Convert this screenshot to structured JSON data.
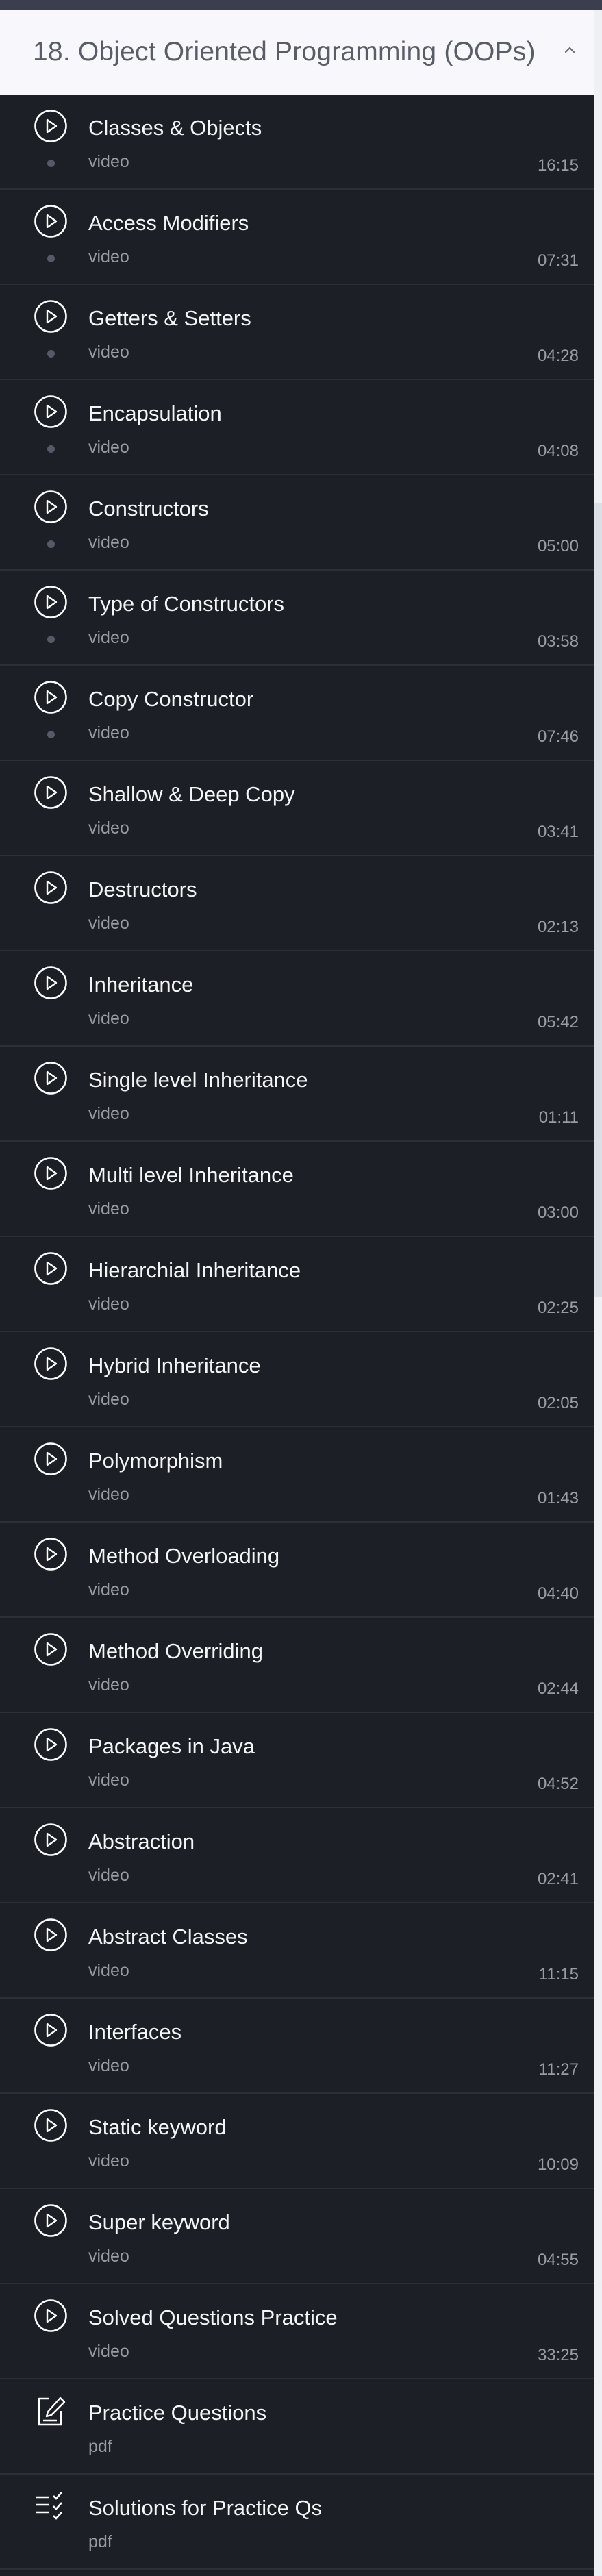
{
  "section": {
    "title": "18. Object Oriented Programming (OOPs)",
    "toggle_icon": "chevron-up-icon"
  },
  "colors": {
    "background": "#1d1f26",
    "header_background": "#f8f8fc",
    "divider": "#2c2f38",
    "title_text": "#f4f5f7",
    "meta_text": "#9a9ca4"
  },
  "lessons": [
    {
      "title": "Classes & Objects",
      "type": "video",
      "duration": "16:15",
      "icon": "play-circle-icon",
      "status_dot": true
    },
    {
      "title": "Access Modifiers",
      "type": "video",
      "duration": "07:31",
      "icon": "play-circle-icon",
      "status_dot": true
    },
    {
      "title": "Getters & Setters",
      "type": "video",
      "duration": "04:28",
      "icon": "play-circle-icon",
      "status_dot": true
    },
    {
      "title": "Encapsulation",
      "type": "video",
      "duration": "04:08",
      "icon": "play-circle-icon",
      "status_dot": true
    },
    {
      "title": "Constructors",
      "type": "video",
      "duration": "05:00",
      "icon": "play-circle-icon",
      "status_dot": true
    },
    {
      "title": "Type of Constructors",
      "type": "video",
      "duration": "03:58",
      "icon": "play-circle-icon",
      "status_dot": true
    },
    {
      "title": "Copy Constructor",
      "type": "video",
      "duration": "07:46",
      "icon": "play-circle-icon",
      "status_dot": true
    },
    {
      "title": "Shallow & Deep Copy",
      "type": "video",
      "duration": "03:41",
      "icon": "play-circle-icon",
      "status_dot": false
    },
    {
      "title": "Destructors",
      "type": "video",
      "duration": "02:13",
      "icon": "play-circle-icon",
      "status_dot": false
    },
    {
      "title": "Inheritance",
      "type": "video",
      "duration": "05:42",
      "icon": "play-circle-icon",
      "status_dot": false
    },
    {
      "title": "Single level Inheritance",
      "type": "video",
      "duration": "01:11",
      "icon": "play-circle-icon",
      "status_dot": false
    },
    {
      "title": "Multi level Inheritance",
      "type": "video",
      "duration": "03:00",
      "icon": "play-circle-icon",
      "status_dot": false
    },
    {
      "title": "Hierarchial Inheritance",
      "type": "video",
      "duration": "02:25",
      "icon": "play-circle-icon",
      "status_dot": false
    },
    {
      "title": "Hybrid Inheritance",
      "type": "video",
      "duration": "02:05",
      "icon": "play-circle-icon",
      "status_dot": false
    },
    {
      "title": "Polymorphism",
      "type": "video",
      "duration": "01:43",
      "icon": "play-circle-icon",
      "status_dot": false
    },
    {
      "title": "Method Overloading",
      "type": "video",
      "duration": "04:40",
      "icon": "play-circle-icon",
      "status_dot": false
    },
    {
      "title": "Method Overriding",
      "type": "video",
      "duration": "02:44",
      "icon": "play-circle-icon",
      "status_dot": false
    },
    {
      "title": "Packages in Java",
      "type": "video",
      "duration": "04:52",
      "icon": "play-circle-icon",
      "status_dot": false
    },
    {
      "title": "Abstraction",
      "type": "video",
      "duration": "02:41",
      "icon": "play-circle-icon",
      "status_dot": false
    },
    {
      "title": "Abstract Classes",
      "type": "video",
      "duration": "11:15",
      "icon": "play-circle-icon",
      "status_dot": false
    },
    {
      "title": "Interfaces",
      "type": "video",
      "duration": "11:27",
      "icon": "play-circle-icon",
      "status_dot": false
    },
    {
      "title": "Static keyword",
      "type": "video",
      "duration": "10:09",
      "icon": "play-circle-icon",
      "status_dot": false
    },
    {
      "title": "Super keyword",
      "type": "video",
      "duration": "04:55",
      "icon": "play-circle-icon",
      "status_dot": false
    },
    {
      "title": "Solved Questions Practice",
      "type": "video",
      "duration": "33:25",
      "icon": "play-circle-icon",
      "status_dot": false
    },
    {
      "title": "Practice Questions",
      "type": "pdf",
      "duration": "",
      "icon": "edit-document-icon",
      "status_dot": false
    },
    {
      "title": "Solutions for Practice Qs",
      "type": "pdf",
      "duration": "",
      "icon": "checklist-icon",
      "status_dot": false
    }
  ]
}
